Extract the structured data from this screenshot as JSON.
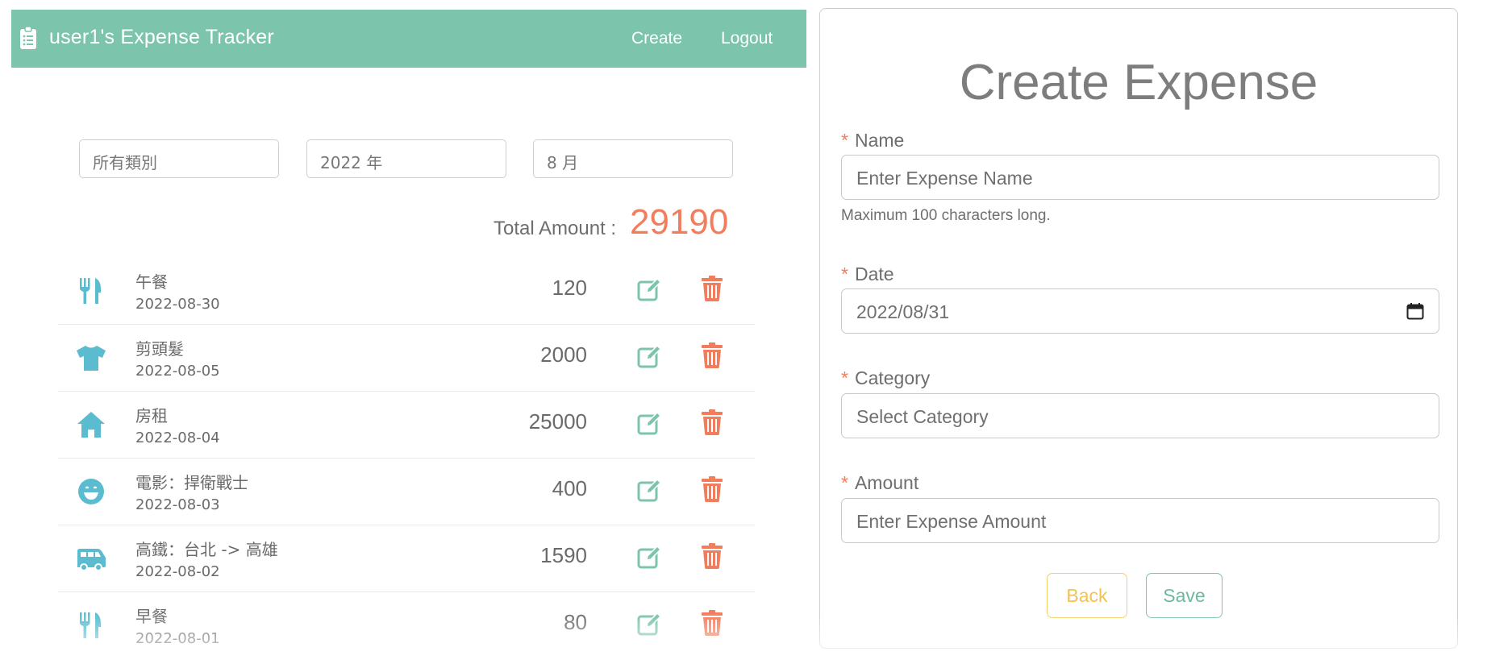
{
  "navbar": {
    "title": "user1's Expense Tracker",
    "brand_icon": "clipboard-list-icon",
    "links": {
      "create": "Create",
      "logout": "Logout"
    },
    "color": "#7cc4ab"
  },
  "filters": {
    "category": "所有類別",
    "year": "2022 年",
    "month": "8 月"
  },
  "total": {
    "label": "Total Amount :",
    "value": "29190",
    "color": "#f27d5d"
  },
  "expenses": [
    {
      "icon": "utensils-icon",
      "name": "午餐",
      "date": "2022-08-30",
      "amount": "120"
    },
    {
      "icon": "tshirt-icon",
      "name": "剪頭髮",
      "date": "2022-08-05",
      "amount": "2000"
    },
    {
      "icon": "home-icon",
      "name": "房租",
      "date": "2022-08-04",
      "amount": "25000"
    },
    {
      "icon": "grin-icon",
      "name": "電影：捍衛戰士",
      "date": "2022-08-03",
      "amount": "400"
    },
    {
      "icon": "shuttle-van-icon",
      "name": "高鐵：台北 -> 高雄",
      "date": "2022-08-02",
      "amount": "1590"
    },
    {
      "icon": "utensils-icon",
      "name": "早餐",
      "date": "2022-08-01",
      "amount": "80"
    }
  ],
  "form": {
    "title": "Create Expense",
    "name_label": "Name",
    "name_placeholder": "Enter Expense Name",
    "name_help": "Maximum 100 characters long.",
    "date_label": "Date",
    "date_value": "2022/08/31",
    "category_label": "Category",
    "category_value": "Select Category",
    "amount_label": "Amount",
    "amount_placeholder": "Enter Expense Amount",
    "required_mark": "*",
    "back_label": "Back",
    "save_label": "Save"
  },
  "colors": {
    "icon": "#5bbcd0",
    "edit": "#7cc4ab",
    "delete": "#f27d5d",
    "back": "#f5cf6c"
  }
}
